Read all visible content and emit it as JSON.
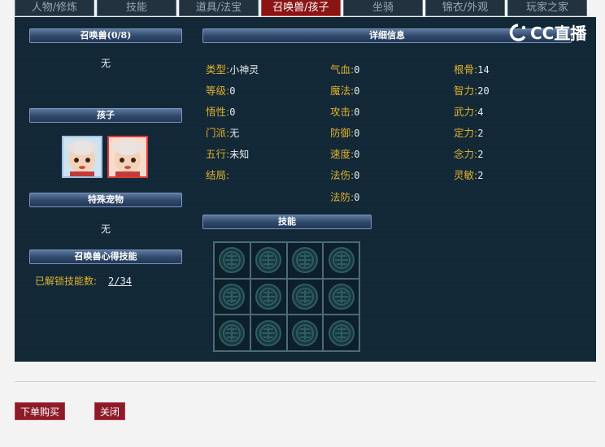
{
  "tabs": [
    {
      "label": "人物/修炼"
    },
    {
      "label": "技能"
    },
    {
      "label": "道具/法宝"
    },
    {
      "label": "召唤兽/孩子"
    },
    {
      "label": "坐骑"
    },
    {
      "label": "锦衣/外观"
    },
    {
      "label": "玩家之家"
    }
  ],
  "left": {
    "summon_header": "召唤兽(0/8)",
    "summon_empty": "无",
    "children_header": "孩子",
    "special_header": "特殊宠物",
    "special_empty": "无",
    "skills_header": "召唤兽心得技能",
    "unlock_label": "已解锁技能数:",
    "unlock_value": "2/34"
  },
  "detail": {
    "header": "详细信息",
    "col1": [
      {
        "k": "类型:",
        "v": "小神灵"
      },
      {
        "k": "等级:",
        "v": "0"
      },
      {
        "k": "悟性:",
        "v": "0"
      },
      {
        "k": "门派:",
        "v": "无"
      },
      {
        "k": "五行:",
        "v": "未知"
      },
      {
        "k": "结局:",
        "v": ""
      }
    ],
    "col2": [
      {
        "k": "气血:",
        "v": "0"
      },
      {
        "k": "魔法:",
        "v": "0"
      },
      {
        "k": "攻击:",
        "v": "0"
      },
      {
        "k": "防御:",
        "v": "0"
      },
      {
        "k": "速度:",
        "v": "0"
      },
      {
        "k": "法伤:",
        "v": "0"
      },
      {
        "k": "法防:",
        "v": "0"
      }
    ],
    "col3": [
      {
        "k": "根骨:",
        "v": "14"
      },
      {
        "k": "智力:",
        "v": "20"
      },
      {
        "k": "武力:",
        "v": "4"
      },
      {
        "k": "定力:",
        "v": "2"
      },
      {
        "k": "念力:",
        "v": "2"
      },
      {
        "k": "灵敏:",
        "v": "2"
      }
    ],
    "skills_header": "技能"
  },
  "watermark": {
    "text": "CC直播"
  },
  "footer": {
    "buy": "下单购买",
    "close": "关闭"
  },
  "colors": {
    "accent_red": "#8d1b2a",
    "label_gold": "#e0b12f",
    "panel_bg": "#112736"
  }
}
